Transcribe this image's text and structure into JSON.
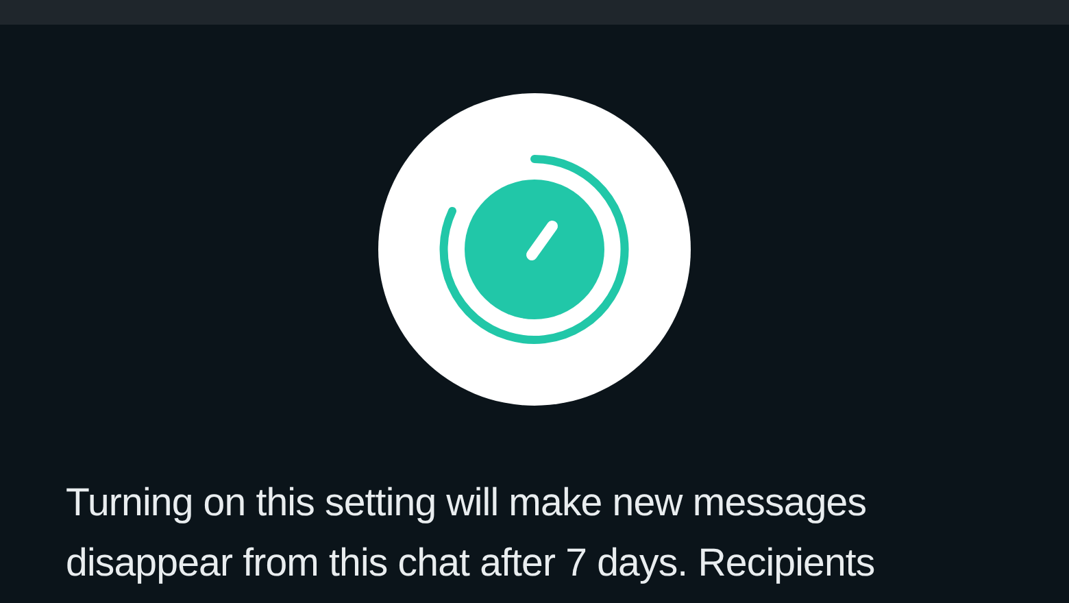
{
  "description": {
    "text": "Turning on this setting will make new messages disappear from this chat after 7 days. Recipients"
  }
}
